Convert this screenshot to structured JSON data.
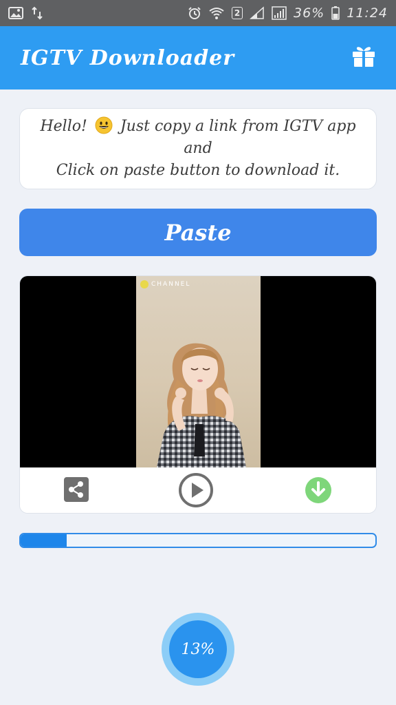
{
  "status_bar": {
    "notification_icons": [
      "gallery-icon",
      "transfer-icon"
    ],
    "sim_badge": "2",
    "battery_text": "36%",
    "time": "11:24"
  },
  "app_bar": {
    "title": "IGTV Downloader",
    "action_icon": "gift-icon"
  },
  "message": {
    "line1_before_emoji": "Hello!",
    "emoji": "smiley-emoji",
    "line1_after_emoji": "Just copy a link from IGTV app and",
    "line2": "Click on paste button to download it."
  },
  "paste_button": {
    "label": "Paste"
  },
  "video": {
    "watermark": "CHANNEL",
    "controls": [
      "share-icon",
      "play-icon",
      "download-icon"
    ]
  },
  "download": {
    "progress_fraction": 0.13,
    "percent_label": "13%"
  },
  "colors": {
    "app_bar": "#2e9cf2",
    "paste_button": "#3f86ea",
    "progress": "#1e86ea",
    "download_icon": "#7ed67a"
  }
}
